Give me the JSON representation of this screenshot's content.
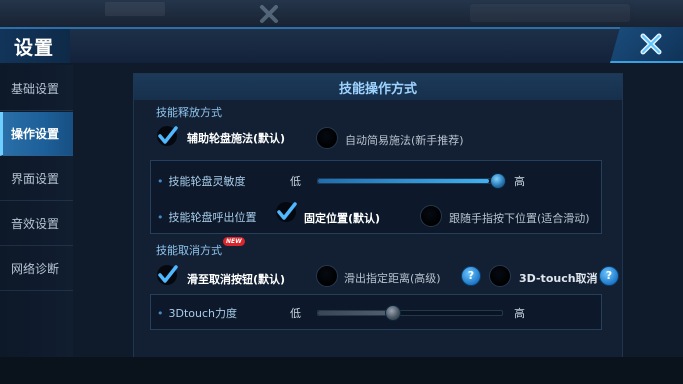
{
  "header": {
    "title": "设置"
  },
  "sidebar": {
    "items": [
      {
        "label": "基础设置",
        "active": false
      },
      {
        "label": "操作设置",
        "active": true
      },
      {
        "label": "界面设置",
        "active": false
      },
      {
        "label": "音效设置",
        "active": false
      },
      {
        "label": "网络诊断",
        "active": false
      }
    ]
  },
  "panel": {
    "title": "技能操作方式",
    "release": {
      "label": "技能释放方式",
      "options": [
        {
          "label": "辅助轮盘施法(默认)",
          "selected": true
        },
        {
          "label": "自动简易施法(新手推荐)",
          "selected": false
        }
      ]
    },
    "sensitivity": {
      "label": "技能轮盘灵敏度",
      "low": "低",
      "high": "高",
      "level": 0.93
    },
    "wheel_position": {
      "label": "技能轮盘呼出位置",
      "options": [
        {
          "label": "固定位置(默认)",
          "selected": true
        },
        {
          "label": "跟随手指按下位置(适合滑动)",
          "selected": false
        }
      ]
    },
    "cancel": {
      "label": "技能取消方式",
      "badge": "NEW",
      "options": [
        {
          "label": "滑至取消按钮(默认)",
          "selected": true
        },
        {
          "label": "滑出指定距离(高级)",
          "selected": false
        },
        {
          "label": "3D-touch取消",
          "selected": false
        }
      ],
      "help_icon": "?"
    },
    "touch_force": {
      "label": "3Dtouch力度",
      "low": "低",
      "high": "高",
      "level": 0.4
    }
  },
  "colors": {
    "accent": "#2a6fa8",
    "highlight": "#3fb2f3",
    "check": "#4fb8ff"
  },
  "icons": {
    "close": "close-icon",
    "check": "check-icon",
    "help": "help-icon"
  }
}
